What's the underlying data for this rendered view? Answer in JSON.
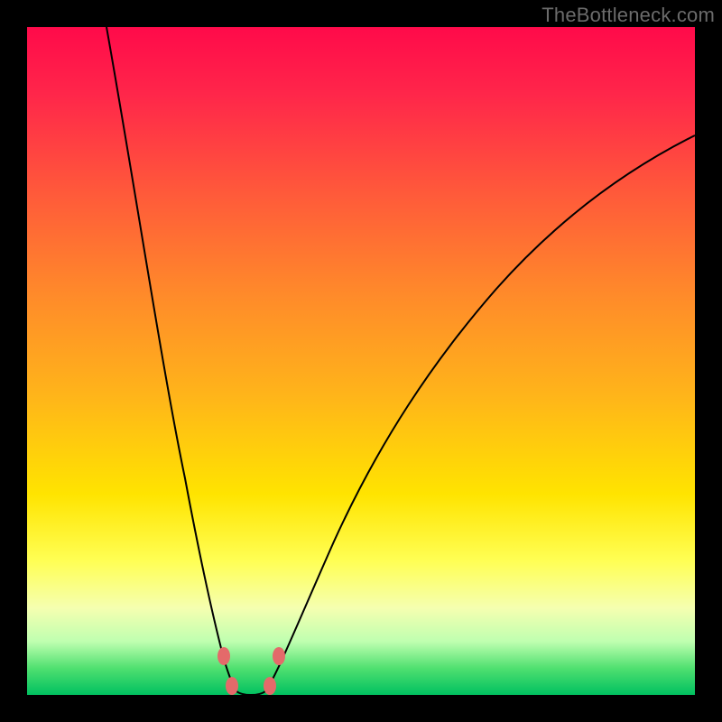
{
  "watermark": "TheBottleneck.com",
  "colors": {
    "top": "#ff0a4a",
    "mid_upper": "#ff8a2a",
    "mid": "#ffe400",
    "lower": "#f5ffb0",
    "bottom": "#00c060",
    "curve_stroke": "#000000",
    "dot_fill": "#e46a6a",
    "frame": "#000000"
  },
  "chart_data": {
    "type": "line",
    "title": "",
    "xlabel": "",
    "ylabel": "",
    "xlim": [
      0,
      100
    ],
    "ylim": [
      0,
      100
    ],
    "left_arm": {
      "x": [
        12,
        16,
        18,
        19.5,
        21,
        22.5,
        24,
        25.5,
        27,
        28,
        29,
        30
      ],
      "y": [
        100,
        70,
        55,
        45,
        36,
        28,
        20,
        14,
        9,
        5,
        2,
        0
      ]
    },
    "right_arm": {
      "x": [
        34,
        36,
        38,
        41,
        45,
        50,
        56,
        63,
        72,
        82,
        92,
        100
      ],
      "y": [
        0,
        4,
        10,
        18,
        28,
        38,
        48,
        57,
        66,
        74,
        80,
        84
      ]
    },
    "trough": {
      "x": [
        30,
        31,
        32,
        33,
        34
      ],
      "y": [
        0,
        0,
        0,
        0,
        0
      ]
    },
    "markers": [
      {
        "x": 27.5,
        "y": 8
      },
      {
        "x": 28.5,
        "y": 2
      },
      {
        "x": 34.5,
        "y": 2
      },
      {
        "x": 35.5,
        "y": 8
      }
    ]
  }
}
